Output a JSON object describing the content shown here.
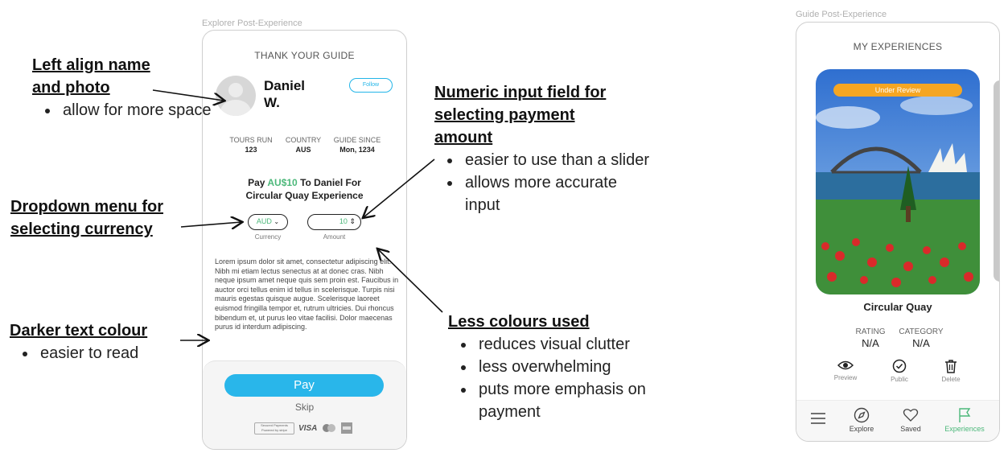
{
  "frames": {
    "left_label": "Explorer Post-Experience",
    "right_label": "Guide Post-Experience"
  },
  "explorer": {
    "title": "THANK YOUR GUIDE",
    "guide_name": "Daniel W.",
    "follow_label": "Follow",
    "stats": [
      {
        "label": "TOURS RUN",
        "value": "123"
      },
      {
        "label": "COUNTRY",
        "value": "AUS"
      },
      {
        "label": "GUIDE SINCE",
        "value": "Mon, 1234"
      }
    ],
    "pay_prefix": "Pay ",
    "pay_amount": "AU$10",
    "pay_suffix": " To Daniel For",
    "pay_line2": "Circular Quay Experience",
    "currency_value": "AUD",
    "currency_caption": "Currency",
    "amount_value": "10",
    "amount_caption": "Amount",
    "lorem": "Lorem ipsum dolor sit amet, consectetur adipiscing elit. Nibh mi etiam lectus senectus at at donec cras. Nibh neque ipsum amet neque quis sem proin est. Faucibus in auctor orci tellus enim id tellus in scelerisque. Turpis nisi mauris egestas quisque augue. Scelerisque laoreet euismod fringilla tempor et, rutrum ultricies. Dui rhoncus bibendum et, ut purus leo vitae facilisi. Dolor maecenas purus id interdum adipiscing.",
    "pay_button": "Pay",
    "skip_label": "Skip",
    "stripe_line1": "Secured Payments",
    "stripe_line2": "Powered by stripe",
    "visa_label": "VISA"
  },
  "annotations": {
    "left_align": {
      "heading1": "Left align name",
      "heading2": "and photo",
      "bullets": [
        "allow for more space"
      ]
    },
    "dropdown": {
      "heading1": "Dropdown menu for",
      "heading2": "selecting currency"
    },
    "darker": {
      "heading": "Darker text colour",
      "bullets": [
        "easier to read"
      ]
    },
    "numeric": {
      "heading1": "Numeric input field for",
      "heading2": "selecting payment",
      "heading3": "amount",
      "bullets": [
        "easier to use than a slider",
        "allows more accurate input"
      ]
    },
    "less_colours": {
      "heading": "Less colours used",
      "bullets": [
        "reduces visual clutter",
        "less overwhelming",
        "puts more emphasis on payment"
      ]
    }
  },
  "guide": {
    "title": "MY EXPERIENCES",
    "badge": "Under Review",
    "experience_name": "Circular Quay",
    "rating_label": "RATING",
    "rating_value": "N/A",
    "category_label": "CATEGORY",
    "category_value": "N/A",
    "actions": [
      "Preview",
      "Public",
      "Delete"
    ],
    "nav": [
      "Explore",
      "Saved",
      "Experiences"
    ]
  },
  "colors": {
    "accent_green": "#4cb87a",
    "pay_blue": "#29b6ea",
    "review_orange": "#f5a623"
  }
}
